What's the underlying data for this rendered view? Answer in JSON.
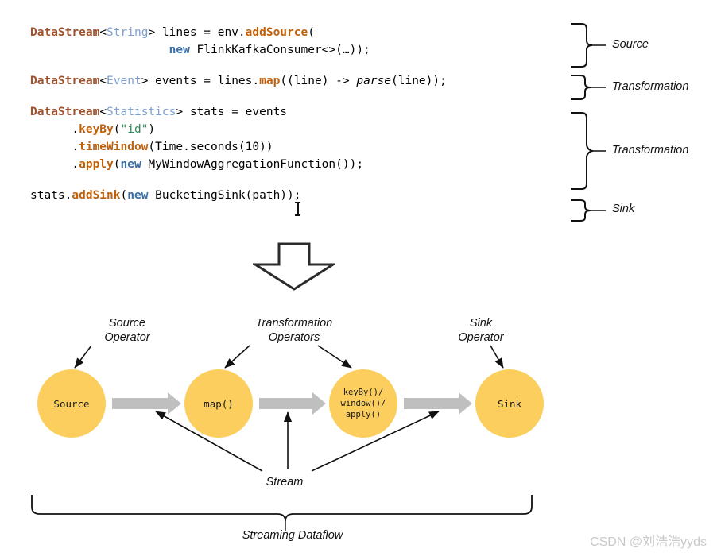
{
  "code": {
    "blocks": [
      {
        "lines": [
          [
            {
              "t": "DataStream",
              "c": "type"
            },
            {
              "t": "<",
              "c": "plain"
            },
            {
              "t": "String",
              "c": "generic"
            },
            {
              "t": "> lines = env.",
              "c": "plain"
            },
            {
              "t": "addSource",
              "c": "method"
            },
            {
              "t": "(",
              "c": "plain"
            }
          ],
          [
            {
              "t": "                    ",
              "c": "plain"
            },
            {
              "t": "new",
              "c": "kw"
            },
            {
              "t": " FlinkKafkaConsumer<>(…));",
              "c": "plain"
            }
          ]
        ]
      },
      {
        "lines": [
          [
            {
              "t": "DataStream",
              "c": "type"
            },
            {
              "t": "<",
              "c": "plain"
            },
            {
              "t": "Event",
              "c": "generic"
            },
            {
              "t": "> events = lines.",
              "c": "plain"
            },
            {
              "t": "map",
              "c": "method"
            },
            {
              "t": "((line) -> ",
              "c": "plain"
            },
            {
              "t": "parse",
              "c": "italic"
            },
            {
              "t": "(line));",
              "c": "plain"
            }
          ]
        ]
      },
      {
        "lines": [
          [
            {
              "t": "DataStream",
              "c": "type"
            },
            {
              "t": "<",
              "c": "plain"
            },
            {
              "t": "Statistics",
              "c": "generic"
            },
            {
              "t": "> stats = events",
              "c": "plain"
            }
          ],
          [
            {
              "t": "      .",
              "c": "plain"
            },
            {
              "t": "keyBy",
              "c": "method"
            },
            {
              "t": "(",
              "c": "plain"
            },
            {
              "t": "\"id\"",
              "c": "str"
            },
            {
              "t": ")",
              "c": "plain"
            }
          ],
          [
            {
              "t": "      .",
              "c": "plain"
            },
            {
              "t": "timeWindow",
              "c": "method"
            },
            {
              "t": "(Time.seconds(10))",
              "c": "plain"
            }
          ],
          [
            {
              "t": "      .",
              "c": "plain"
            },
            {
              "t": "apply",
              "c": "method"
            },
            {
              "t": "(",
              "c": "plain"
            },
            {
              "t": "new",
              "c": "kw"
            },
            {
              "t": " MyWindowAggregationFunction());",
              "c": "plain"
            }
          ]
        ]
      },
      {
        "lines": [
          [
            {
              "t": "stats.",
              "c": "plain"
            },
            {
              "t": "addSink",
              "c": "method"
            },
            {
              "t": "(",
              "c": "plain"
            },
            {
              "t": "new",
              "c": "kw"
            },
            {
              "t": " BucketingSink(path));",
              "c": "plain"
            }
          ]
        ]
      }
    ],
    "brace_labels": [
      {
        "label": "Source"
      },
      {
        "label": "Transformation"
      },
      {
        "label": "Transformation"
      },
      {
        "label": "Sink"
      }
    ]
  },
  "diagram": {
    "operators": [
      {
        "name": "source",
        "text": "Source"
      },
      {
        "name": "map",
        "text": "map()"
      },
      {
        "name": "window",
        "text": "keyBy()/\nwindow()/\napply()"
      },
      {
        "name": "sink",
        "text": "Sink"
      }
    ],
    "annotations": {
      "source_operator": "Source\nOperator",
      "transformation_operators": "Transformation\nOperators",
      "sink_operator": "Sink\nOperator",
      "stream": "Stream",
      "streaming_dataflow": "Streaming Dataflow"
    },
    "colors": {
      "operator_fill": "#fbce5e",
      "flow_arrow": "#bfbfbf",
      "stroke": "#111111"
    }
  },
  "watermark": {
    "text": "CSDN @刘浩浩yyds"
  }
}
